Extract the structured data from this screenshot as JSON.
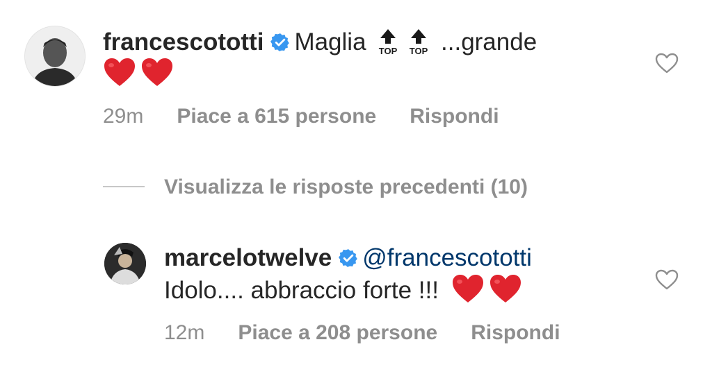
{
  "comments": [
    {
      "username": "francescototti",
      "text_word": "Maglia",
      "emoji_label": "TOP",
      "text_after": "...grande",
      "time": "29m",
      "likes": "Piace a 615 persone",
      "reply": "Rispondi"
    },
    {
      "username": "marcelotwelve",
      "mention": "@francescototti",
      "text": "Idolo.... abbraccio forte !!!",
      "time": "12m",
      "likes": "Piace a 208 persone",
      "reply": "Rispondi"
    }
  ],
  "view_replies": "Visualizza le risposte precedenti (10)",
  "colors": {
    "verified": "#3897f0",
    "heart": "#e0242e",
    "meta": "#8e8e8e",
    "mention": "#00376b"
  }
}
